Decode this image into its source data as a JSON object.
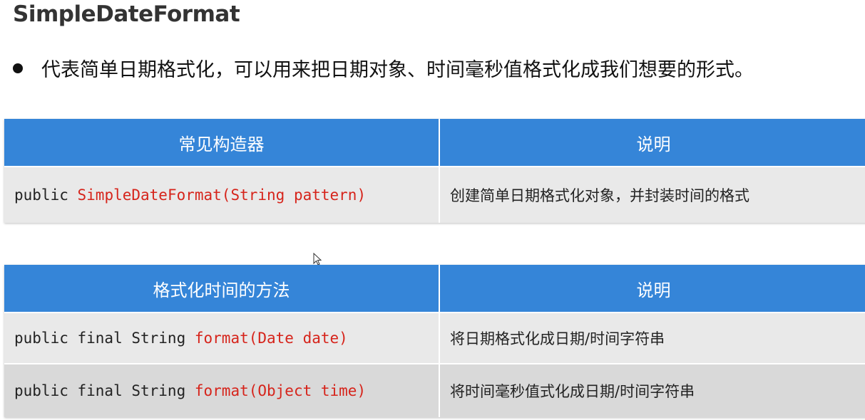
{
  "title": "SimpleDateFormat",
  "bullet": "代表简单日期格式化，可以用来把日期对象、时间毫秒值格式化成我们想要的形式。",
  "colors": {
    "header_bg": "#3585d8",
    "row_bg": "#e9e9e9",
    "row_alt_bg": "#d9d9d9",
    "method_highlight": "#d6241b"
  },
  "constructors_table": {
    "headers": [
      "常见构造器",
      "说明"
    ],
    "rows": [
      {
        "code_prefix": "public ",
        "code_highlight": "SimpleDateFormat(String pattern)",
        "description": "创建简单日期格式化对象，并封装时间的格式"
      }
    ]
  },
  "methods_table": {
    "headers": [
      "格式化时间的方法",
      "说明"
    ],
    "rows": [
      {
        "code_prefix": "public final String ",
        "code_highlight": "format(Date date)",
        "description": "将日期格式化成日期/时间字符串"
      },
      {
        "code_prefix": "public final String ",
        "code_highlight": "format(Object time)",
        "description": "将时间毫秒值式化成日期/时间字符串"
      }
    ]
  }
}
